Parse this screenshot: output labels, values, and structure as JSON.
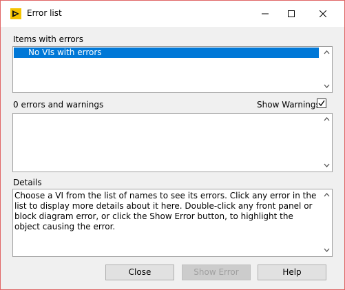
{
  "window": {
    "title": "Error list",
    "icons": {
      "app": "labview-warning-icon",
      "minimize": "minimize-icon",
      "maximize": "maximize-icon",
      "close": "close-icon"
    }
  },
  "items_section": {
    "label": "Items with errors",
    "items": [
      "No VIs with errors"
    ]
  },
  "errors_section": {
    "label": "0 errors and warnings",
    "show_warnings_label": "Show Warnings",
    "show_warnings_checked": true
  },
  "details_section": {
    "label": "Details",
    "text": "Choose a VI from the list of names to see its errors. Click any error in the list to display more details about it here. Double-click any front panel or block diagram error, or click the Show Error button, to highlight the object causing the error."
  },
  "buttons": {
    "close": "Close",
    "show_error": "Show Error",
    "help": "Help"
  },
  "colors": {
    "selection": "#0078d7",
    "window_border": "#e06565"
  }
}
